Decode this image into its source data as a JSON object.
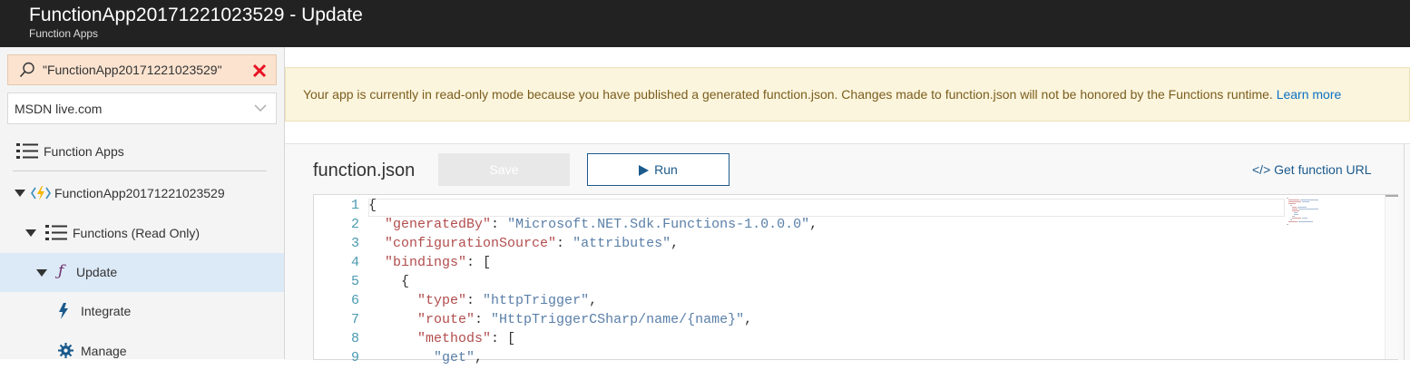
{
  "header": {
    "title": "FunctionApp20171221023529 - Update",
    "subtitle": "Function Apps"
  },
  "sidebar": {
    "search_value": "\"FunctionApp20171221023529\"",
    "subscription": "MSDN live.com",
    "items": [
      {
        "label": "Function Apps",
        "icon": "list-icon"
      },
      {
        "label": "FunctionApp20171221023529",
        "icon": "function-app-icon"
      },
      {
        "label": "Functions (Read Only)",
        "icon": "list-icon"
      },
      {
        "label": "Update",
        "icon": "function-icon",
        "active": true
      },
      {
        "label": "Integrate",
        "icon": "lightning-icon"
      },
      {
        "label": "Manage",
        "icon": "gear-icon"
      }
    ]
  },
  "banner": {
    "message": "Your app is currently in read-only mode because you have published a generated function.json. Changes made to function.json will not be honored by the Functions runtime.",
    "link": "Learn more"
  },
  "editor_panel": {
    "file_name": "function.json",
    "save_label": "Save",
    "run_label": "Run",
    "get_url_label": "</> Get function URL"
  },
  "code": {
    "line_numbers": [
      "1",
      "2",
      "3",
      "4",
      "5",
      "6",
      "7",
      "8",
      "9"
    ],
    "lines": [
      "{",
      "  \"generatedBy\": \"Microsoft.NET.Sdk.Functions-1.0.0.0\",",
      "  \"configurationSource\": \"attributes\",",
      "  \"bindings\": [",
      "    {",
      "      \"type\": \"httpTrigger\",",
      "      \"route\": \"HttpTriggerCSharp/name/{name}\",",
      "      \"methods\": [",
      "        \"get\","
    ]
  },
  "colors": {
    "topbar": "#222222",
    "banner_bg": "#fcf5dd",
    "accent": "#1b5a8c",
    "json_key": "#b24d4d",
    "json_string": "#5a7fa8",
    "line_number": "#4a9ab0"
  }
}
